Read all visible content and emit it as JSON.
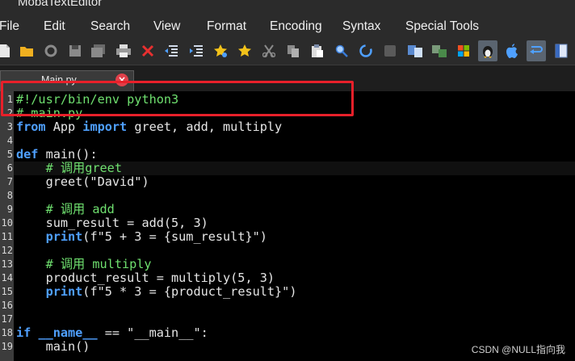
{
  "window": {
    "title": "MobaTextEditor"
  },
  "menu": [
    "File",
    "Edit",
    "Search",
    "View",
    "Format",
    "Encoding",
    "Syntax",
    "Special Tools"
  ],
  "toolbar": {
    "icons": [
      "new-file-icon",
      "open-folder-icon",
      "reload-icon",
      "save-icon",
      "save-all-icon",
      "print-icon",
      "close-file-icon",
      "outdent-icon",
      "indent-icon",
      "bookmark-star-icon",
      "favorite-star-icon",
      "cut-icon",
      "copy-icon",
      "paste-icon",
      "find-icon",
      "find-replace-icon",
      "compare-icon",
      "split-view-icon",
      "sync-icon",
      "windows-icon",
      "linux-icon",
      "mac-icon",
      "word-wrap-icon",
      "panel-icon"
    ],
    "active": [
      "linux-icon",
      "word-wrap-icon"
    ]
  },
  "tab": {
    "label": "Main.py",
    "close": "×"
  },
  "editor": {
    "lines": [
      {
        "n": "1",
        "tokens": [
          {
            "t": "#!/usr/bin/env python3",
            "c": "cm"
          }
        ]
      },
      {
        "n": "2",
        "tokens": [
          {
            "t": "# main.py",
            "c": "cm"
          }
        ]
      },
      {
        "n": "3",
        "tokens": [
          {
            "t": "from",
            "c": "kw"
          },
          {
            "t": " App ",
            "c": ""
          },
          {
            "t": "import",
            "c": "kw"
          },
          {
            "t": " greet, add, multiply",
            "c": ""
          }
        ]
      },
      {
        "n": "4",
        "tokens": []
      },
      {
        "n": "5",
        "tokens": [
          {
            "t": "def",
            "c": "kw"
          },
          {
            "t": " main():",
            "c": ""
          }
        ]
      },
      {
        "n": "6",
        "tokens": [
          {
            "t": "    ",
            "c": ""
          },
          {
            "t": "# 调用greet",
            "c": "cm"
          }
        ]
      },
      {
        "n": "7",
        "tokens": [
          {
            "t": "    greet(\"David\")",
            "c": ""
          }
        ]
      },
      {
        "n": "8",
        "tokens": []
      },
      {
        "n": "9",
        "tokens": [
          {
            "t": "    ",
            "c": ""
          },
          {
            "t": "# 调用 add",
            "c": "cm"
          }
        ]
      },
      {
        "n": "10",
        "tokens": [
          {
            "t": "    sum_result = add(5, 3)",
            "c": ""
          }
        ]
      },
      {
        "n": "11",
        "tokens": [
          {
            "t": "    ",
            "c": ""
          },
          {
            "t": "print",
            "c": "kw"
          },
          {
            "t": "(f\"5 + 3 = {sum_result}\")",
            "c": ""
          }
        ]
      },
      {
        "n": "12",
        "tokens": []
      },
      {
        "n": "13",
        "tokens": [
          {
            "t": "    ",
            "c": ""
          },
          {
            "t": "# 调用 multiply",
            "c": "cm"
          }
        ]
      },
      {
        "n": "14",
        "tokens": [
          {
            "t": "    product_result = multiply(5, 3)",
            "c": ""
          }
        ]
      },
      {
        "n": "15",
        "tokens": [
          {
            "t": "    ",
            "c": ""
          },
          {
            "t": "print",
            "c": "kw"
          },
          {
            "t": "(f\"5 * 3 = {product_result}\")",
            "c": ""
          }
        ]
      },
      {
        "n": "16",
        "tokens": []
      },
      {
        "n": "17",
        "tokens": []
      },
      {
        "n": "18",
        "tokens": [
          {
            "t": "if",
            "c": "kw"
          },
          {
            "t": " ",
            "c": ""
          },
          {
            "t": "__name__",
            "c": "kw"
          },
          {
            "t": " == \"__main__\":",
            "c": ""
          }
        ]
      },
      {
        "n": "19",
        "tokens": [
          {
            "t": "    main()",
            "c": ""
          }
        ]
      }
    ],
    "current_line": "6"
  },
  "watermark": "CSDN @NULL指向我",
  "colors": {
    "keyword": "#4fa0ff",
    "comment": "#6fe06f",
    "highlight_box": "#e8202a",
    "tab_close": "#e0404a"
  }
}
